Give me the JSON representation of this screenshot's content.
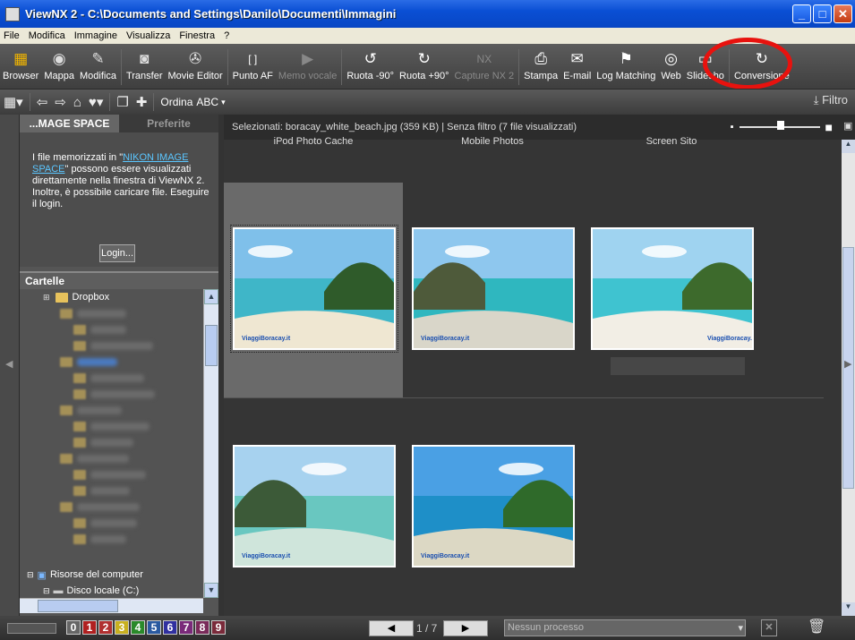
{
  "window": {
    "title": "ViewNX 2 - C:\\Documents and Settings\\Danilo\\Documenti\\Immagini"
  },
  "menu": [
    "File",
    "Modifica",
    "Immagine",
    "Visualizza",
    "Finestra",
    "?"
  ],
  "toolbar": [
    {
      "label": "Browser",
      "icon": "browser-icon",
      "glyph": "▦",
      "color": "#f0b400",
      "enabled": true
    },
    {
      "label": "Mappa",
      "icon": "globe-icon",
      "glyph": "◉",
      "color": "#dddddd",
      "enabled": true
    },
    {
      "label": "Modifica",
      "icon": "edit-icon",
      "glyph": "✎",
      "color": "#dddddd",
      "enabled": true
    },
    {
      "sep": true
    },
    {
      "label": "Transfer",
      "icon": "camera-icon",
      "glyph": "◙",
      "color": "#dddddd",
      "enabled": true
    },
    {
      "label": "Movie Editor",
      "icon": "film-reel-icon",
      "glyph": "✇",
      "color": "#dddddd",
      "enabled": true
    },
    {
      "sep": true
    },
    {
      "label": "Punto AF",
      "icon": "af-point-icon",
      "glyph": "[ ]",
      "color": "#ffffff",
      "enabled": true
    },
    {
      "label": "Memo vocale",
      "icon": "voice-memo-icon",
      "glyph": "▶",
      "color": "#888888",
      "enabled": false
    },
    {
      "sep": true
    },
    {
      "label": "Ruota -90°",
      "icon": "rotate-left-icon",
      "glyph": "↺",
      "color": "#ffffff",
      "enabled": true
    },
    {
      "label": "Ruota +90°",
      "icon": "rotate-right-icon",
      "glyph": "↻",
      "color": "#ffffff",
      "enabled": true
    },
    {
      "label": "Capture NX 2",
      "icon": "capture-nx-icon",
      "glyph": "NX",
      "color": "#888888",
      "enabled": false
    },
    {
      "sep": true
    },
    {
      "label": "Stampa",
      "icon": "printer-icon",
      "glyph": "⎙",
      "color": "#ffffff",
      "enabled": true
    },
    {
      "label": "E-mail",
      "icon": "envelope-icon",
      "glyph": "✉",
      "color": "#ffffff",
      "enabled": true
    },
    {
      "label": "Log Matching",
      "icon": "log-matching-icon",
      "glyph": "⚑",
      "color": "#ffffff",
      "enabled": true
    },
    {
      "label": "Web",
      "icon": "web-icon",
      "glyph": "◎",
      "color": "#ffffff",
      "enabled": true
    },
    {
      "label": "Slidesho",
      "icon": "slideshow-icon",
      "glyph": "▭",
      "color": "#ffffff",
      "enabled": true
    },
    {
      "sep": true
    },
    {
      "label": "Conversione",
      "icon": "convert-type-icon",
      "glyph": "↻",
      "color": "#ffffff",
      "enabled": true
    }
  ],
  "toolbar2": {
    "sort_label": "Ordina",
    "sort_value": "ABC",
    "filter_label": "Filtro"
  },
  "left_panel": {
    "tab_active": "...MAGE SPACE",
    "tab_inactive": "Preferite",
    "nis_text_before": "I file memorizzati in \"",
    "nis_link": "NIKON IMAGE SPACE",
    "nis_text_after": "\" possono essere visualizzati direttamente nella finestra di ViewNX 2. Inoltre, è possibile caricare file. Eseguire il login.",
    "login_button": "Login...",
    "folders_header": "Cartelle",
    "dropbox": "Dropbox",
    "computer": "Risorse del computer",
    "disk": "Disco locale (C:)"
  },
  "main": {
    "status": "Selezionati: boracay_white_beach.jpg (359 KB) | Senza filtro  (7 file visualizzati)",
    "partial_captions": [
      "iPod Photo Cache",
      "Mobile Photos",
      "Screen Sito"
    ],
    "thumbnails": [
      {
        "name": "boracay-white-beach-thumbnail",
        "sky": "#7fc0ea",
        "sea": "#3fb6c8",
        "sand": "#efe7d2",
        "land": "#2f5b2a",
        "selected": true
      },
      {
        "name": "cliff-islands-thumbnail",
        "sky": "#8ec7ee",
        "sea": "#2fb7bf",
        "sand": "#d9d6c9",
        "land": "#4e5a3a",
        "selected": false
      },
      {
        "name": "palm-tree-beach-thumbnail",
        "sky": "#9fd3f0",
        "sea": "#3fc3d0",
        "sand": "#f2eee5",
        "land": "#3d6a2c",
        "selected": false
      },
      {
        "name": "outrigger-boat-thumbnail",
        "sky": "#a7d2ef",
        "sea": "#69c7c0",
        "sand": "#cfe5db",
        "land": "#3c5a38",
        "selected": false
      },
      {
        "name": "coastline-aerial-thumbnail",
        "sky": "#4aa0e4",
        "sea": "#1e8fc8",
        "sand": "#dcd8c4",
        "land": "#2f6a2a",
        "selected": false
      }
    ],
    "watermark": "ViaggiBoracay.it",
    "page": "1 / 7"
  },
  "statusbar": {
    "labels": [
      "0",
      "1",
      "2",
      "3",
      "4",
      "5",
      "6",
      "7",
      "8",
      "9"
    ],
    "label_colors": [
      "#666666",
      "#b02020",
      "#b03030",
      "#c8b020",
      "#2a8a2a",
      "#2a5aa0",
      "#3030a0",
      "#7a2a7a",
      "#7a2a5a",
      "#7a2a3a"
    ],
    "process": "Nessun processo"
  }
}
